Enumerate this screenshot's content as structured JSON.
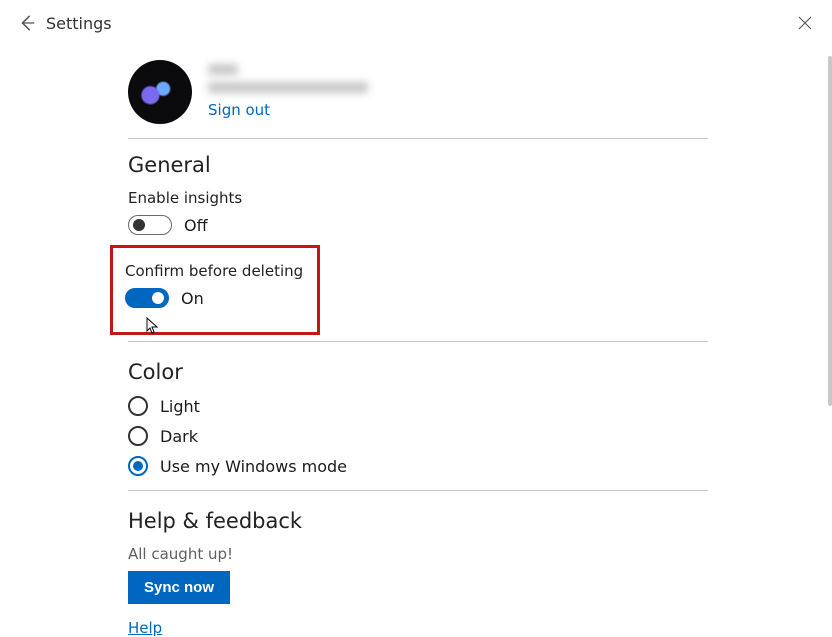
{
  "header": {
    "title": "Settings"
  },
  "profile": {
    "sign_out": "Sign out"
  },
  "general": {
    "heading": "General",
    "enable_insights": {
      "label": "Enable insights",
      "state_label": "Off"
    },
    "confirm_delete": {
      "label": "Confirm before deleting",
      "state_label": "On"
    }
  },
  "color": {
    "heading": "Color",
    "options": {
      "light": "Light",
      "dark": "Dark",
      "windows": "Use my Windows mode"
    }
  },
  "help": {
    "heading": "Help & feedback",
    "status": "All caught up!",
    "sync_btn": "Sync now",
    "help_link": "Help"
  }
}
